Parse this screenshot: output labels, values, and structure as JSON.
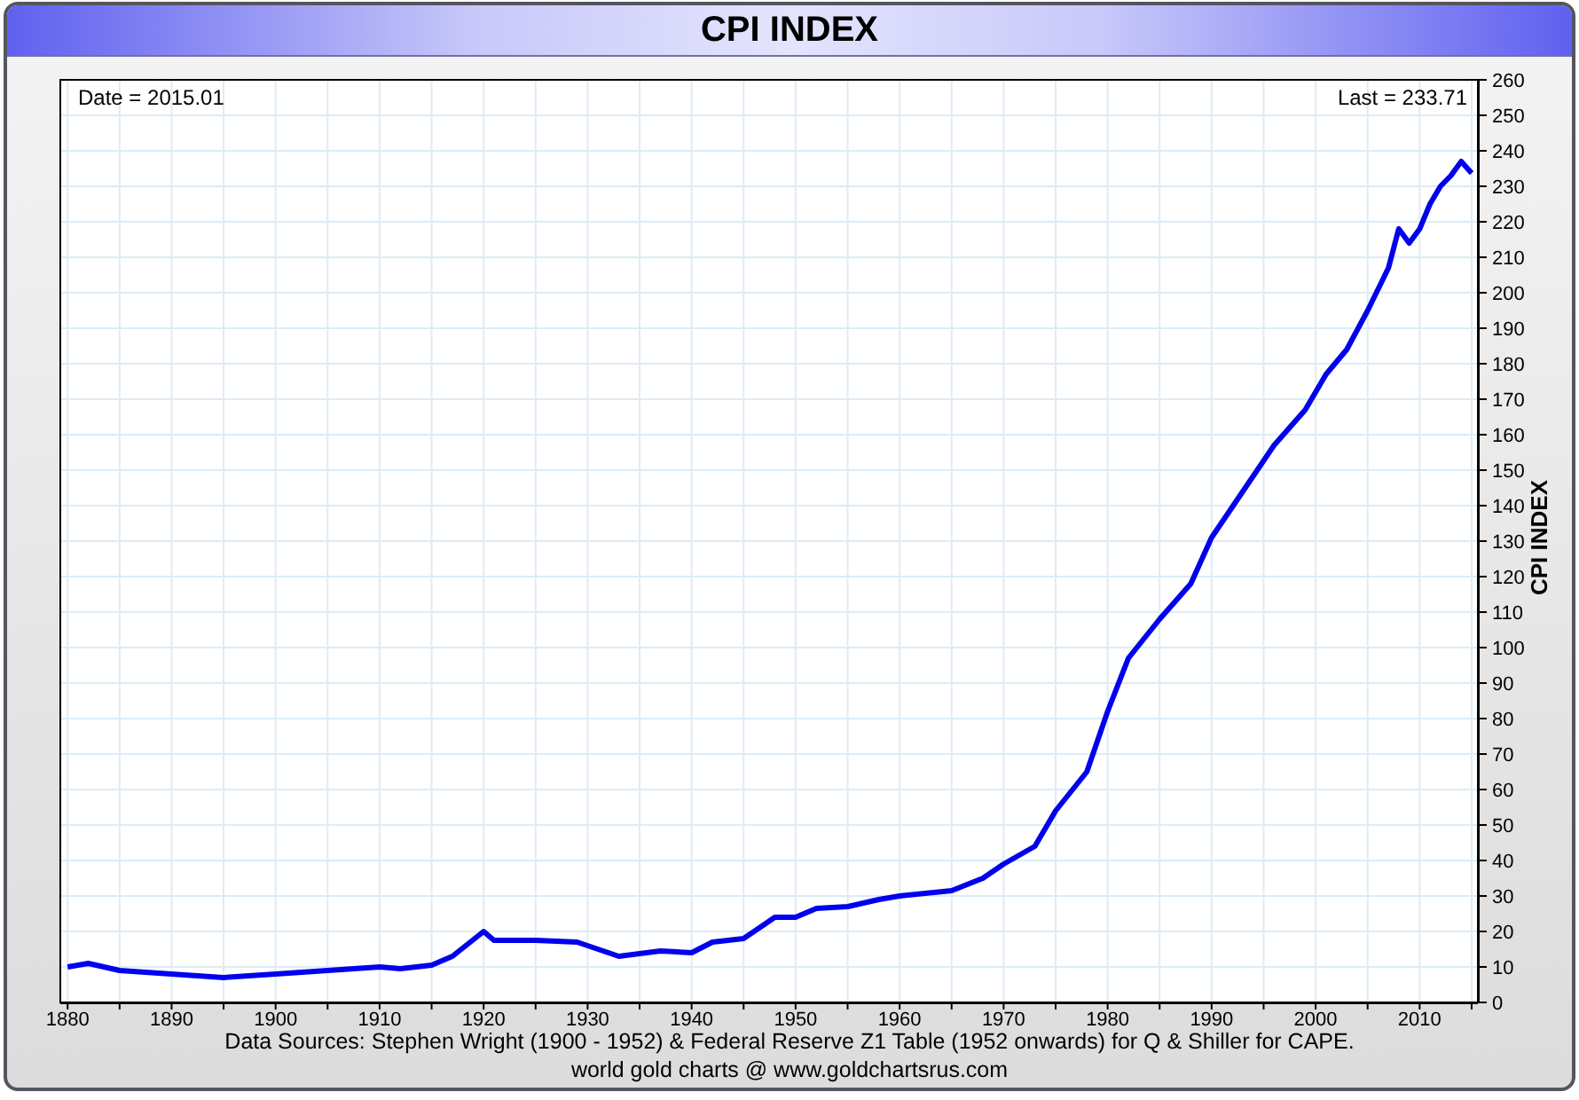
{
  "window": {
    "title": "CPI INDEX"
  },
  "chart": {
    "date_label": "Date = 2015.01",
    "last_label": "Last = 233.71",
    "chart_data": {
      "type": "line",
      "ylabel": "CPI INDEX",
      "xlim": [
        1879.3,
        2015.6
      ],
      "ylim": [
        0,
        260
      ],
      "xticks": [
        1880,
        1890,
        1900,
        1910,
        1920,
        1930,
        1940,
        1950,
        1960,
        1970,
        1980,
        1990,
        2000,
        2010
      ],
      "yticks": [
        0,
        10,
        20,
        30,
        40,
        50,
        60,
        70,
        80,
        90,
        100,
        110,
        120,
        130,
        140,
        150,
        160,
        170,
        180,
        190,
        200,
        210,
        220,
        230,
        240,
        250,
        260
      ],
      "x": [
        1880,
        1882,
        1885,
        1890,
        1895,
        1900,
        1905,
        1910,
        1912,
        1915,
        1917,
        1920,
        1921,
        1925,
        1929,
        1933,
        1937,
        1940,
        1942,
        1945,
        1947,
        1948,
        1950,
        1952,
        1955,
        1958,
        1960,
        1965,
        1968,
        1970,
        1973,
        1975,
        1978,
        1980,
        1982,
        1985,
        1988,
        1990,
        1993,
        1996,
        1999,
        2001,
        2003,
        2005,
        2007,
        2008,
        2009,
        2010,
        2011,
        2012,
        2013,
        2014,
        2015.01
      ],
      "grid": true,
      "series": [
        {
          "color": "#0000ee",
          "values": [
            10,
            11,
            9,
            8,
            7,
            8,
            9,
            10,
            9.5,
            10.5,
            13,
            20,
            17.5,
            17.5,
            17,
            13,
            14.5,
            14,
            17,
            18,
            22,
            24,
            24,
            26.5,
            27,
            29,
            30,
            31.5,
            35,
            39,
            44,
            54,
            65,
            82,
            97,
            108,
            118,
            131,
            144,
            157,
            167,
            177,
            184,
            195,
            207,
            218,
            214,
            218,
            225,
            230,
            233,
            237,
            233.7
          ]
        }
      ]
    }
  },
  "footer": {
    "sources": "Data Sources: Stephen Wright (1900 - 1952) & Federal Reserve Z1 Table (1952 onwards) for Q & Shiller for CAPE.",
    "credit": "world gold charts @ www.goldchartsrus.com"
  }
}
